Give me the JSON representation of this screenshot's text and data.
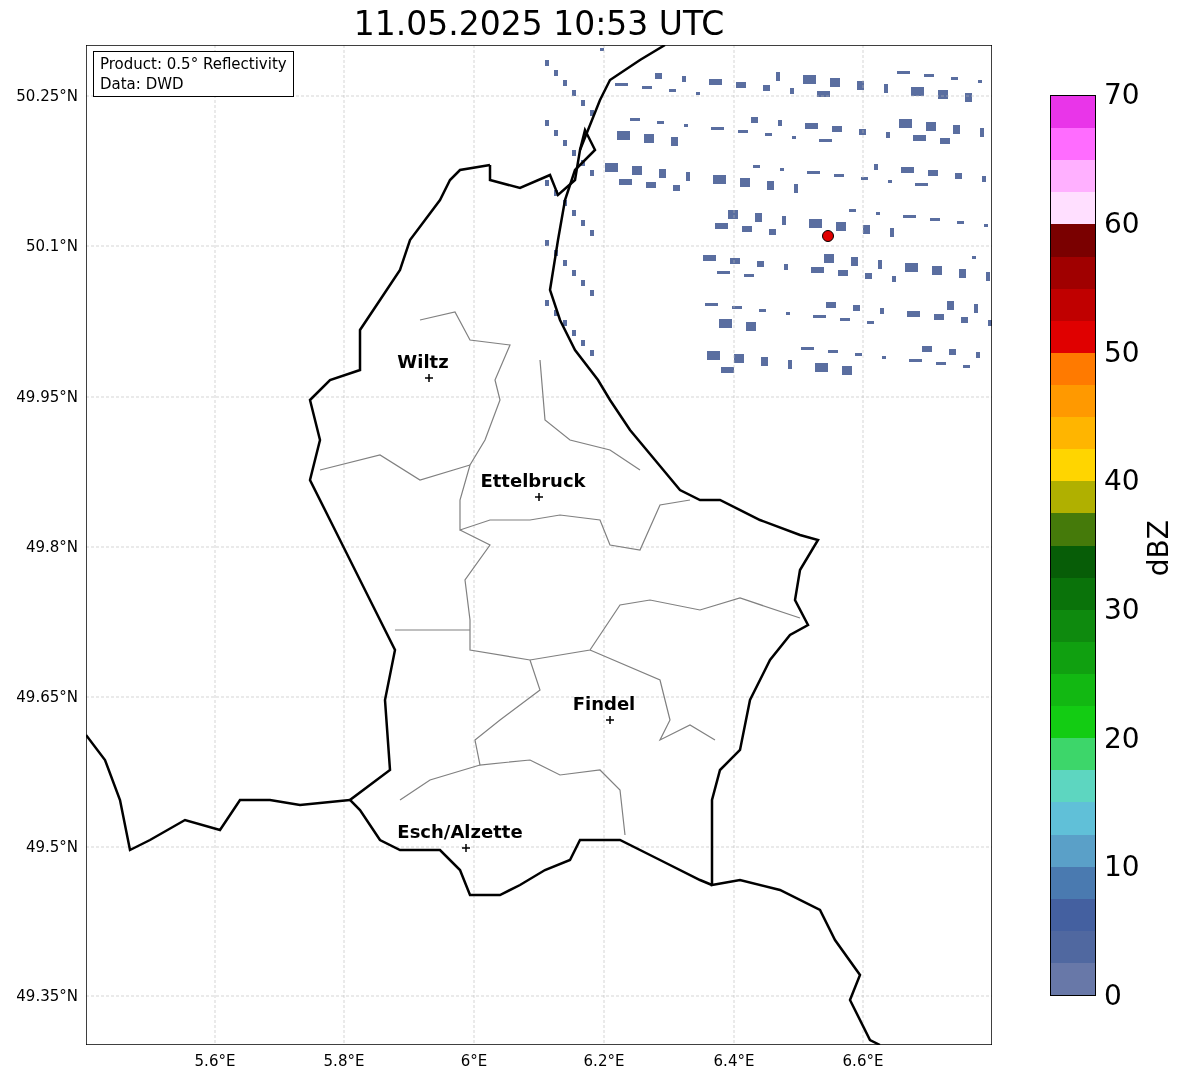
{
  "title": "11.05.2025 10:53 UTC",
  "info_box": {
    "lines": [
      "Product: 0.5° Reflectivity",
      "Data: DWD"
    ]
  },
  "map": {
    "y_ticks": [
      "50.25°N",
      "50.1°N",
      "49.95°N",
      "49.8°N",
      "49.65°N",
      "49.5°N",
      "49.35°N"
    ],
    "x_ticks": [
      "5.6°E",
      "5.8°E",
      "6°E",
      "6.2°E",
      "6.4°E",
      "6.6°E"
    ],
    "cities": [
      {
        "name": "Wiltz"
      },
      {
        "name": "Ettelbruck"
      },
      {
        "name": "Findel"
      },
      {
        "name": "Esch/Alzette"
      }
    ]
  },
  "colorbar": {
    "label": "dBZ",
    "ticks": [
      "70",
      "60",
      "50",
      "40",
      "30",
      "20",
      "10",
      "0"
    ],
    "bands": [
      {
        "color": "#e935e9"
      },
      {
        "color": "#ff6cff"
      },
      {
        "color": "#ffb0ff"
      },
      {
        "color": "#ffdfff"
      },
      {
        "color": "#7a0000"
      },
      {
        "color": "#a00000"
      },
      {
        "color": "#c00000"
      },
      {
        "color": "#e00000"
      },
      {
        "color": "#ff7a00"
      },
      {
        "color": "#ff9900"
      },
      {
        "color": "#ffb500"
      },
      {
        "color": "#ffd500"
      },
      {
        "color": "#b0b000"
      },
      {
        "color": "#457a0a"
      },
      {
        "color": "#075d07"
      },
      {
        "color": "#0a730a"
      },
      {
        "color": "#0e8a0e"
      },
      {
        "color": "#10a010"
      },
      {
        "color": "#12b812"
      },
      {
        "color": "#13cc13"
      },
      {
        "color": "#3dd66a"
      },
      {
        "color": "#5dd6c0"
      },
      {
        "color": "#60c0d8"
      },
      {
        "color": "#5aa0c8"
      },
      {
        "color": "#4a7ab0"
      },
      {
        "color": "#4460a0"
      },
      {
        "color": "#5068a0"
      },
      {
        "color": "#6878a8"
      }
    ]
  }
}
